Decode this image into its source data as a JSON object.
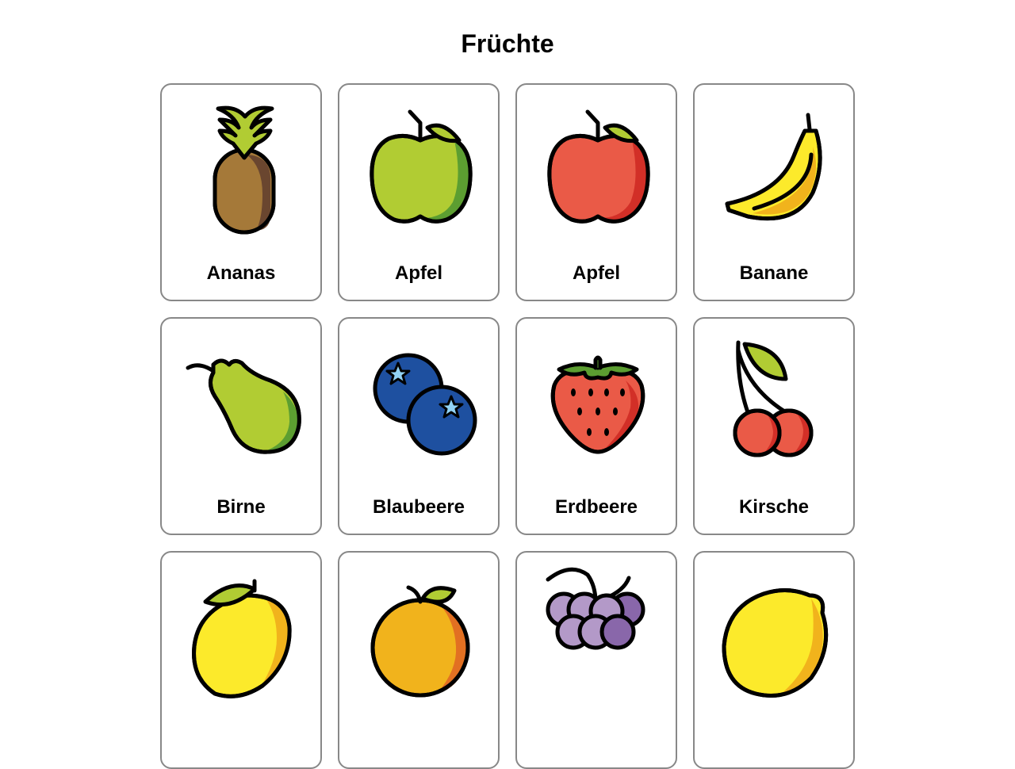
{
  "page": {
    "title": "Früchte"
  },
  "cards": [
    {
      "label": "Ananas",
      "icon": "pineapple-icon"
    },
    {
      "label": "Apfel",
      "icon": "green-apple-icon"
    },
    {
      "label": "Apfel",
      "icon": "red-apple-icon"
    },
    {
      "label": "Banane",
      "icon": "banana-icon"
    },
    {
      "label": "Birne",
      "icon": "pear-icon"
    },
    {
      "label": "Blaubeere",
      "icon": "blueberries-icon"
    },
    {
      "label": "Erdbeere",
      "icon": "strawberry-icon"
    },
    {
      "label": "Kirsche",
      "icon": "cherries-icon"
    },
    {
      "label": "",
      "icon": "mango-icon"
    },
    {
      "label": "",
      "icon": "orange-icon"
    },
    {
      "label": "",
      "icon": "grapes-icon"
    },
    {
      "label": "",
      "icon": "lemon-icon"
    }
  ]
}
